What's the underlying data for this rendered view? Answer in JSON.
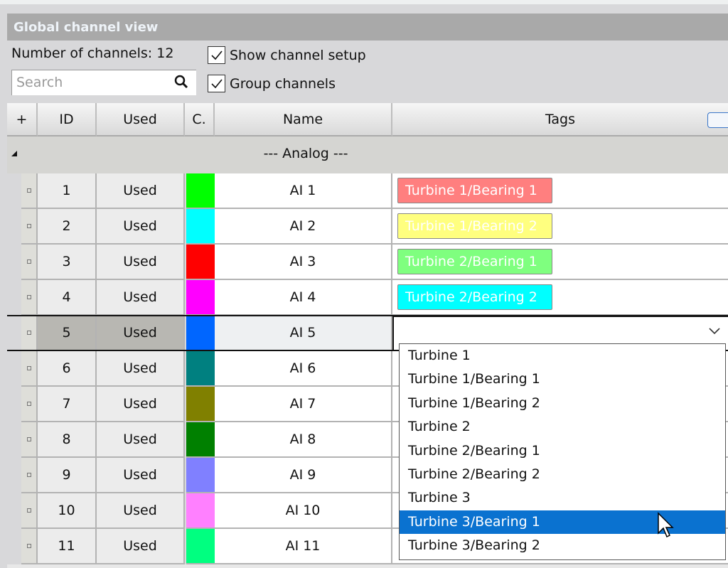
{
  "panel": {
    "title": "Global channel view",
    "channel_count_label": "Number of channels: 12"
  },
  "search": {
    "placeholder": "Search",
    "icon": "search-icon"
  },
  "options": {
    "show_channel_setup": {
      "label": "Show channel setup",
      "checked": true
    },
    "group_channels": {
      "label": "Group channels",
      "checked": true
    }
  },
  "columns": {
    "add": "+",
    "id": "ID",
    "used": "Used",
    "color": "C.",
    "name": "Name",
    "tags": "Tags"
  },
  "group": {
    "label": "--- Analog ---"
  },
  "rows": [
    {
      "id": "1",
      "used": "Used",
      "color": "#00ff00",
      "name": "AI 1",
      "tag": "Turbine 1/Bearing 1",
      "tag_color": "#ff7f7f"
    },
    {
      "id": "2",
      "used": "Used",
      "color": "#00ffff",
      "name": "AI 2",
      "tag": "Turbine 1/Bearing 2",
      "tag_color": "#ffff7f"
    },
    {
      "id": "3",
      "used": "Used",
      "color": "#ff0000",
      "name": "AI 3",
      "tag": "Turbine 2/Bearing 1",
      "tag_color": "#7fff7f"
    },
    {
      "id": "4",
      "used": "Used",
      "color": "#ff00ff",
      "name": "AI 4",
      "tag": "Turbine 2/Bearing 2",
      "tag_color": "#00ffff"
    },
    {
      "id": "5",
      "used": "Used",
      "color": "#0066ff",
      "name": "AI 5",
      "selected": true
    },
    {
      "id": "6",
      "used": "Used",
      "color": "#008080",
      "name": "AI 6"
    },
    {
      "id": "7",
      "used": "Used",
      "color": "#808000",
      "name": "AI 7"
    },
    {
      "id": "8",
      "used": "Used",
      "color": "#008000",
      "name": "AI 8"
    },
    {
      "id": "9",
      "used": "Used",
      "color": "#8080ff",
      "name": "AI 9"
    },
    {
      "id": "10",
      "used": "Used",
      "color": "#ff80ff",
      "name": "AI 10"
    },
    {
      "id": "11",
      "used": "Used",
      "color": "#00ff80",
      "name": "AI 11"
    }
  ],
  "tag_dropdown": {
    "options": [
      "Turbine 1",
      "Turbine 1/Bearing 1",
      "Turbine 1/Bearing 2",
      "Turbine 2",
      "Turbine 2/Bearing 1",
      "Turbine 2/Bearing 2",
      "Turbine 3",
      "Turbine 3/Bearing 1",
      "Turbine 3/Bearing 2"
    ],
    "highlighted": "Turbine 3/Bearing 1",
    "highlight_color": "#0a72d0"
  }
}
